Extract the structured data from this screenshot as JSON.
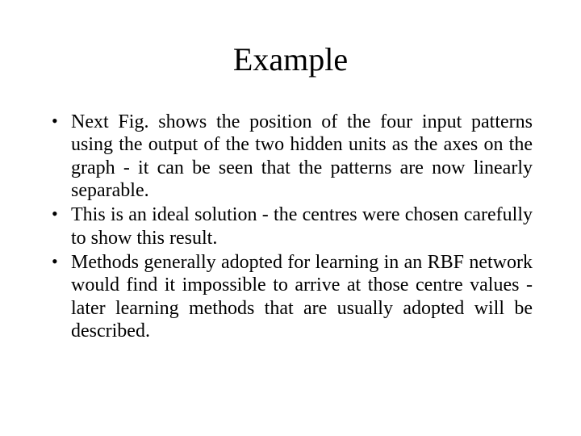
{
  "slide": {
    "title": "Example",
    "bullets": [
      "Next Fig. shows the position of the four input patterns using the output of the two hidden units as the axes on the graph - it can be seen that the patterns are now linearly separable.",
      "This is an ideal solution - the centres were chosen carefully to show this result.",
      "Methods generally adopted for learning in an RBF network would find it impossible to arrive at those centre values - later learning methods that are usually adopted will be described."
    ]
  }
}
